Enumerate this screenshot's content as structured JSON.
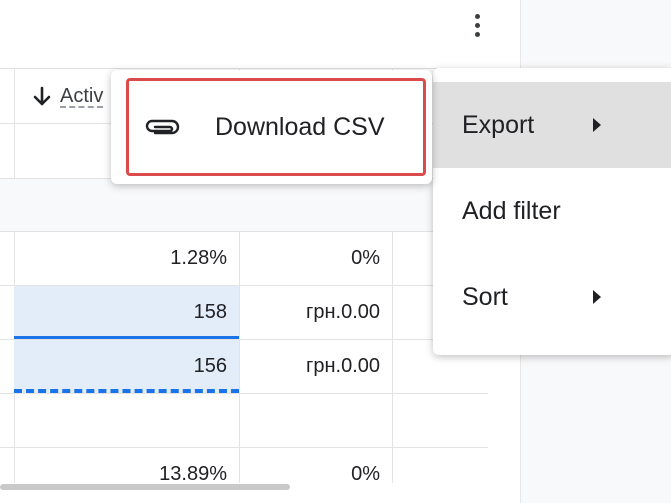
{
  "table": {
    "sort_header": "Activ",
    "rows": [
      {
        "col1": "1.28%",
        "col2": "0%"
      },
      {
        "col1": "158",
        "col2": "грн.0.00"
      },
      {
        "col1": "156",
        "col2": "грн.0.00"
      },
      {
        "col1": "",
        "col2": ""
      },
      {
        "col1": "13.89%",
        "col2": "0%"
      }
    ]
  },
  "menu": {
    "items": [
      {
        "label": "Export"
      },
      {
        "label": "Add filter"
      },
      {
        "label": "Sort"
      }
    ]
  },
  "submenu": {
    "download_csv": "Download CSV",
    "icon": "paperclip-icon"
  },
  "colors": {
    "accent": "#1a73e8",
    "highlight_border": "#dc4b4b",
    "selected_row": "#e3ecf9"
  }
}
